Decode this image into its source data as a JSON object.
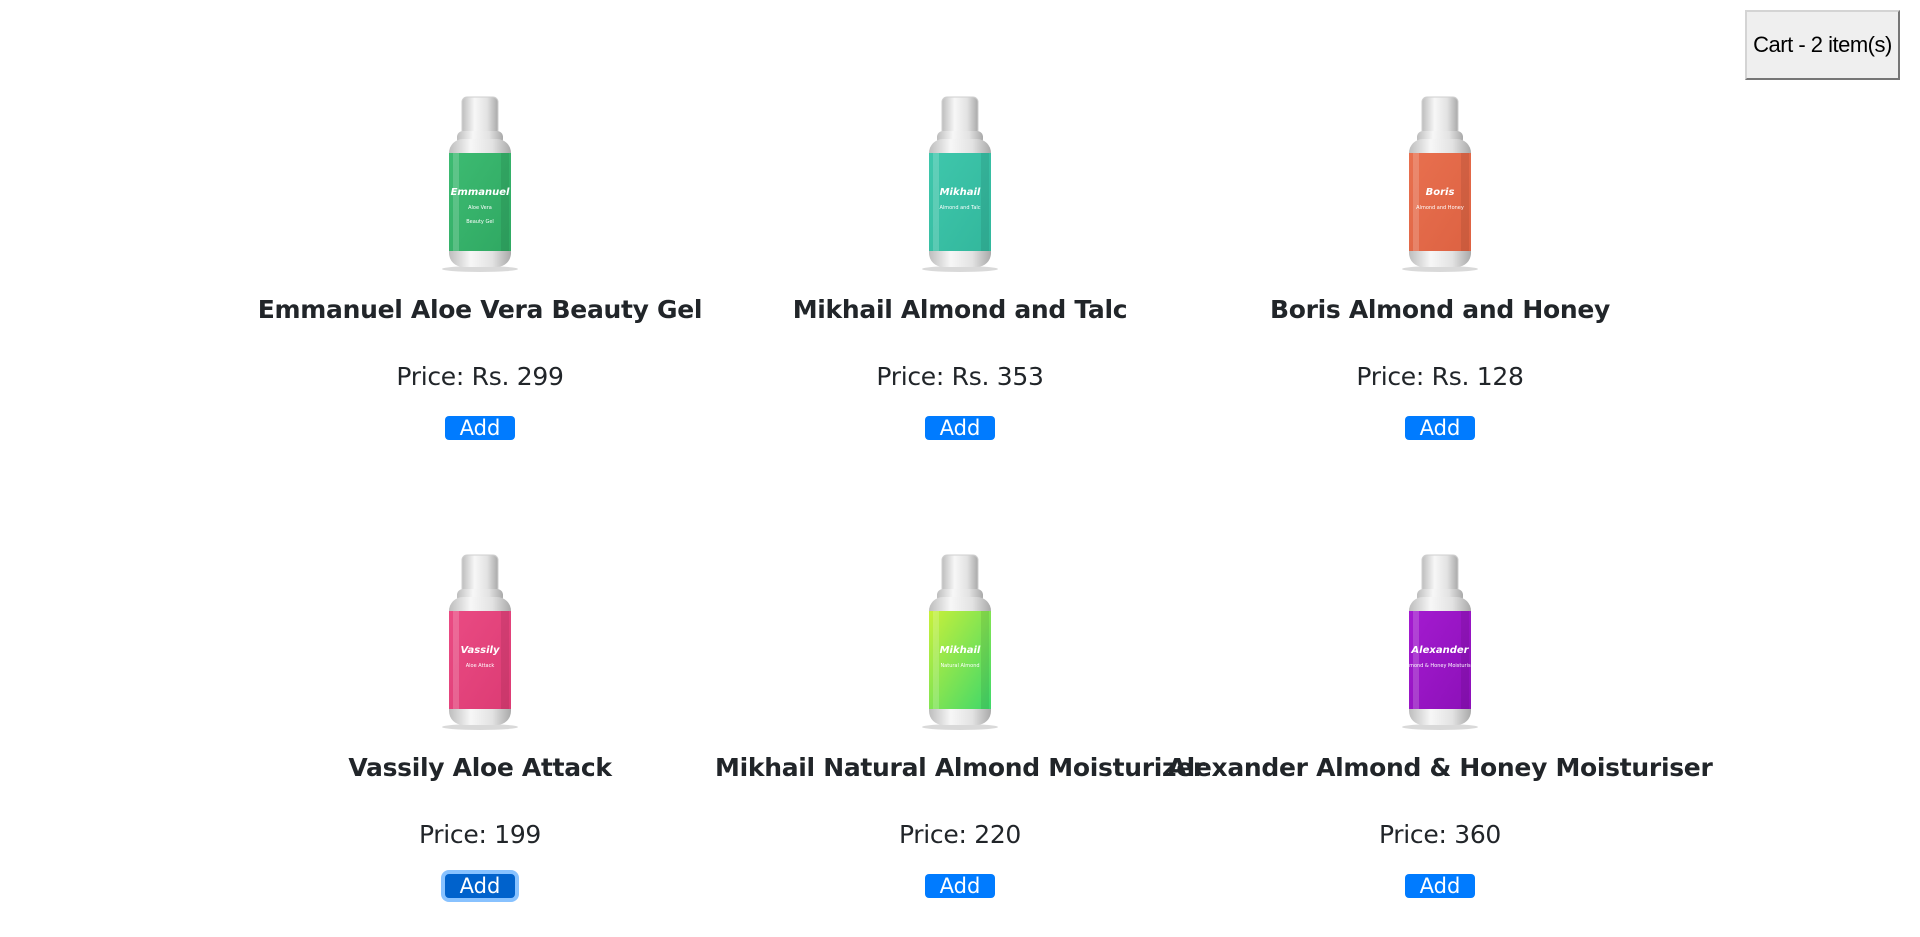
{
  "cart": {
    "label": "Cart - 2 item(s)"
  },
  "products": [
    {
      "name": "Emmanuel Aloe Vera Beauty Gel",
      "price": "Price: Rs. 299",
      "add_label": "Add",
      "label_color": "#3dbb72",
      "label_color_2": "#2fa862",
      "brand_lines": [
        "Emmanuel",
        "Aloe Vera",
        "Beauty Gel"
      ]
    },
    {
      "name": "Mikhail Almond and Talc",
      "price": "Price: Rs. 353",
      "add_label": "Add",
      "label_color": "#3fc7ac",
      "label_color_2": "#32b79c",
      "brand_lines": [
        "Mikhail",
        "Almond and Talc"
      ]
    },
    {
      "name": "Boris Almond and Honey",
      "price": "Price: Rs. 128",
      "add_label": "Add",
      "label_color": "#e8704f",
      "label_color_2": "#dd6242",
      "brand_lines": [
        "Boris",
        "Almond and Honey"
      ]
    },
    {
      "name": "Vassily Aloe Attack",
      "price": "Price: 199",
      "add_label": "Add",
      "label_color": "#ea4b83",
      "label_color_2": "#dc3b74",
      "brand_lines": [
        "Vassily",
        "Aloe Attack"
      ]
    },
    {
      "name": "Mikhail Natural Almond Moisturizer",
      "price": "Price: 220",
      "add_label": "Add",
      "label_color": "#c8f03a",
      "label_color_2": "#3ed86a",
      "brand_lines": [
        "Mikhail",
        "Natural Almond"
      ]
    },
    {
      "name": "Alexander Almond & Honey Moisturiser",
      "price": "Price: 360",
      "add_label": "Add",
      "label_color": "#a41bd0",
      "label_color_2": "#8c10b8",
      "brand_lines": [
        "Alexander",
        "Almond & Honey Moisturiser"
      ]
    }
  ]
}
